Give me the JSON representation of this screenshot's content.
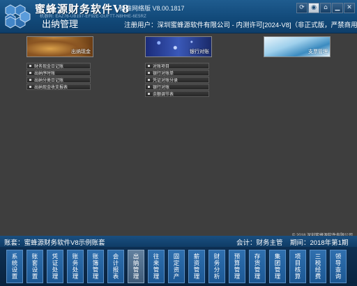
{
  "header": {
    "brand": "蜜蜂源财务软件V8",
    "version": "标准网络版 V8.00.1817",
    "machine_code": "机器码: EAZ76-UB197-EF92E-GUFTT-N8HHE-6E5RZ",
    "module": "出纳管理",
    "registration": "注册用户：深圳蜜蜂源软件有限公司 - 内测许可[2024-V8]（非正式版，严禁商用）",
    "window_buttons": [
      "refresh-icon",
      "eye-icon",
      "network-icon",
      "minimize-icon",
      "close-icon"
    ]
  },
  "groups": [
    {
      "banner": "出纳现金",
      "items": [
        "财务现金日记账",
        "出纳序时账",
        "出纳分类日记账",
        "出纳现金收支报表"
      ]
    },
    {
      "banner": "银行对账",
      "items": [
        "对账项目",
        "银行对账单",
        "凭证对账分录",
        "银行对账",
        "余额调节表"
      ]
    },
    {
      "banner": "支票管理",
      "items": []
    }
  ],
  "copyright": "© 2018 深圳蜜蜂源软件有限公司",
  "status": {
    "account_set": "账套：蜜蜂源财务软件V8示例账套",
    "accountant": "会计：财务主管",
    "period": "期间：2018年第1期"
  },
  "nav": [
    {
      "label": "系统设置",
      "active": false
    },
    {
      "label": "账套设置",
      "active": false
    },
    {
      "label": "凭证处理",
      "active": false
    },
    {
      "label": "账务处理",
      "active": false
    },
    {
      "label": "账簿管理",
      "active": false
    },
    {
      "label": "会计报表",
      "active": false
    },
    {
      "label": "出纳管理",
      "active": true
    },
    {
      "label": "往来管理",
      "active": false
    },
    {
      "label": "固定资产",
      "active": false
    },
    {
      "label": "薪资管理",
      "active": false
    },
    {
      "label": "财务分析",
      "active": false
    },
    {
      "label": "预算管理",
      "active": false
    },
    {
      "label": "存货管理",
      "active": false
    },
    {
      "label": "集团管理",
      "active": false
    },
    {
      "label": "项目核算",
      "active": false
    },
    {
      "label": "三税经费",
      "active": false
    },
    {
      "label": "领导查询",
      "active": false
    }
  ]
}
